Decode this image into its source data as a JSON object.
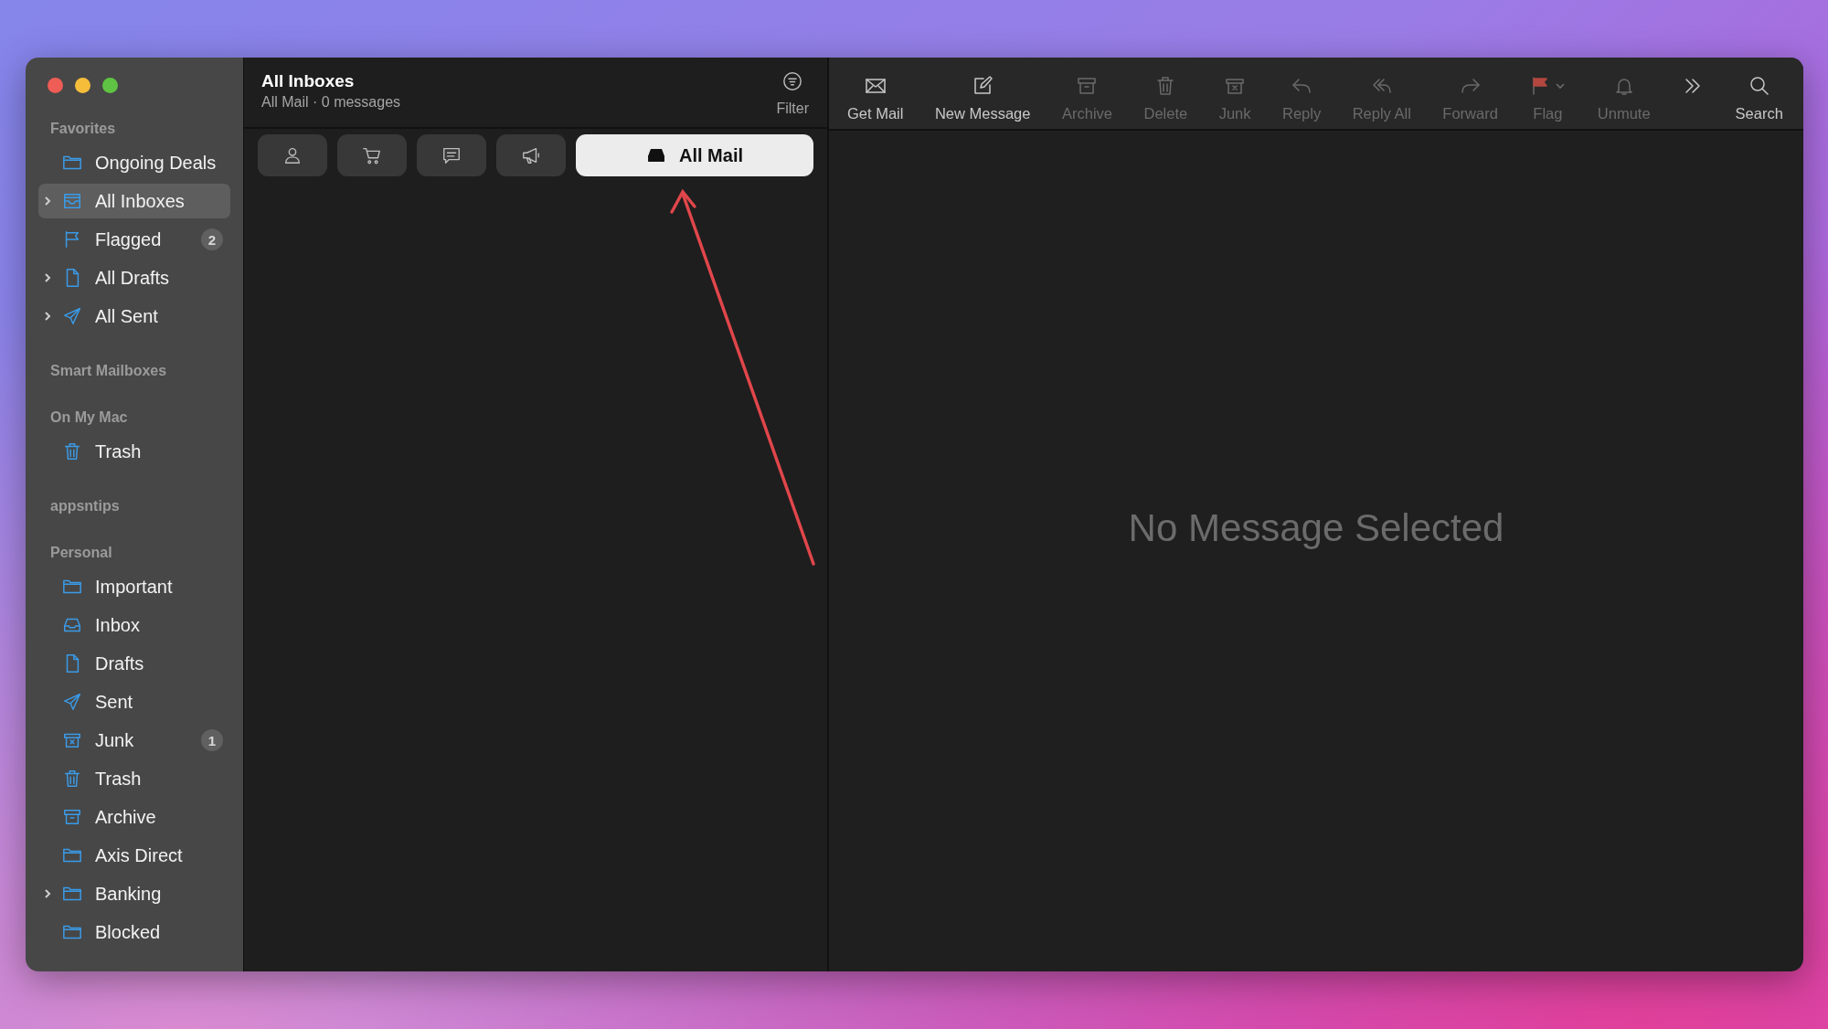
{
  "sidebar": {
    "sections": [
      {
        "title": "Favorites",
        "items": [
          {
            "label": "Ongoing Deals",
            "kind": "folder",
            "selected": false
          },
          {
            "label": "All Inboxes",
            "kind": "inboxes",
            "selected": true,
            "expanded": false
          },
          {
            "label": "Flagged",
            "kind": "flag",
            "selected": false,
            "badge": "2"
          },
          {
            "label": "All Drafts",
            "kind": "doc",
            "selected": false,
            "expanded": false
          },
          {
            "label": "All Sent",
            "kind": "sent",
            "selected": false,
            "expanded": false
          }
        ]
      },
      {
        "title": "Smart Mailboxes"
      },
      {
        "title": "On My Mac",
        "items": [
          {
            "label": "Trash",
            "kind": "trash",
            "selected": false
          }
        ]
      },
      {
        "title": "appsntips"
      },
      {
        "title": "Personal",
        "items": [
          {
            "label": "Important",
            "kind": "folder",
            "selected": false
          },
          {
            "label": "Inbox",
            "kind": "inbox",
            "selected": false
          },
          {
            "label": "Drafts",
            "kind": "doc",
            "selected": false
          },
          {
            "label": "Sent",
            "kind": "sent",
            "selected": false
          },
          {
            "label": "Junk",
            "kind": "junk",
            "selected": false,
            "badge": "1"
          },
          {
            "label": "Trash",
            "kind": "trash",
            "selected": false
          },
          {
            "label": "Archive",
            "kind": "archive",
            "selected": false
          },
          {
            "label": "Axis Direct",
            "kind": "folder",
            "selected": false
          },
          {
            "label": "Banking",
            "kind": "folder",
            "selected": false,
            "expanded": false
          },
          {
            "label": "Blocked",
            "kind": "folder",
            "selected": false
          }
        ]
      }
    ]
  },
  "message_list": {
    "title": "All Inboxes",
    "subtitle": "All Mail · 0 messages",
    "filter_label": "Filter",
    "categories": [
      {
        "kind": "person",
        "selected": false
      },
      {
        "kind": "cart",
        "selected": false
      },
      {
        "kind": "chat",
        "selected": false
      },
      {
        "kind": "megaphone",
        "selected": false
      },
      {
        "kind": "inbox",
        "label": "All Mail",
        "selected": true
      }
    ]
  },
  "toolbar": [
    {
      "label": "Get Mail",
      "kind": "envelope",
      "disabled": false
    },
    {
      "label": "New Message",
      "kind": "compose",
      "disabled": false
    },
    {
      "label": "Archive",
      "kind": "archive",
      "disabled": true
    },
    {
      "label": "Delete",
      "kind": "trash",
      "disabled": true
    },
    {
      "label": "Junk",
      "kind": "junk",
      "disabled": true
    },
    {
      "label": "Reply",
      "kind": "reply",
      "disabled": true
    },
    {
      "label": "Reply All",
      "kind": "replyall",
      "disabled": true
    },
    {
      "label": "Forward",
      "kind": "forward",
      "disabled": true
    },
    {
      "label": "Flag",
      "kind": "flagfill",
      "disabled": true
    },
    {
      "label": "Unmute",
      "kind": "bell",
      "disabled": true
    },
    {
      "kind": "more",
      "disabled": false
    },
    {
      "label": "Search",
      "kind": "search",
      "disabled": false
    }
  ],
  "viewer": {
    "empty_text": "No Message Selected"
  }
}
